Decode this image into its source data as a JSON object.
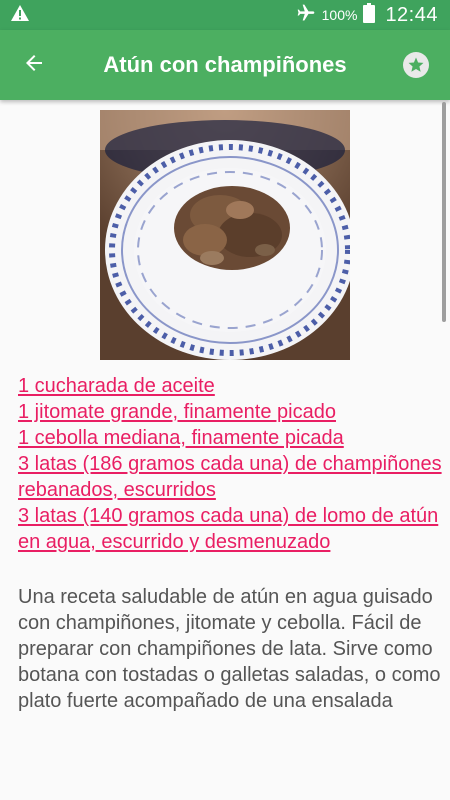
{
  "status_bar": {
    "battery_percent": "100%",
    "time": "12:44",
    "icons": [
      "warning-icon",
      "airplane-mode-icon",
      "battery-icon"
    ]
  },
  "app_bar": {
    "title": "Atún con champiñones",
    "back_icon": "arrow-back-icon",
    "favorite_icon": "star-icon"
  },
  "recipe": {
    "image_alt": "plate-photo",
    "ingredients": [
      "1 cucharada de aceite",
      "1 jitomate grande, finamente picado",
      "1 cebolla mediana, finamente picada",
      "3 latas (186 gramos cada una) de champiñones rebanados, escurridos",
      "3 latas (140 gramos cada una) de lomo de atún en agua, escurrido y desmenuzado"
    ],
    "description": "Una receta saludable de atún en agua guisado con champiñones, jitomate y cebolla. Fácil de preparar con champiñones de lata. Sirve como botana con tostadas o galletas saladas, o como plato fuerte acompañado de una ensalada"
  },
  "colors": {
    "status_bar": "#3fa35d",
    "app_bar": "#4caf61",
    "link": "#e91e63",
    "body_text": "#555555",
    "background": "#fafafa"
  }
}
